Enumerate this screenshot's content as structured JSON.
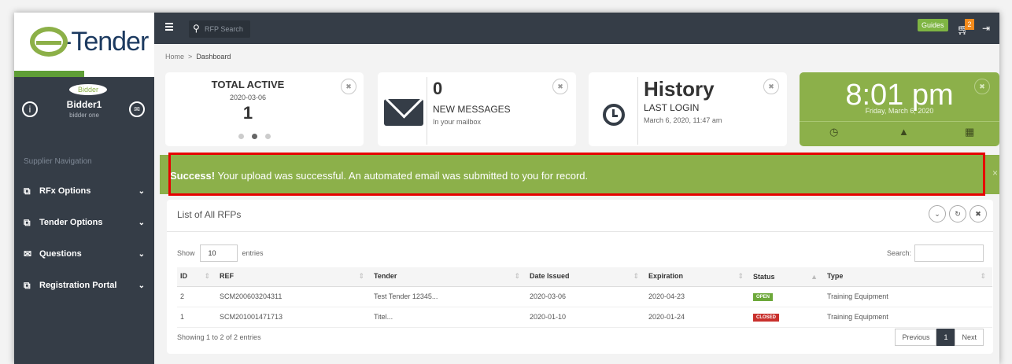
{
  "brand": {
    "logo_text": "-Tender"
  },
  "user": {
    "role": "Bidder",
    "name": "Bidder1",
    "sub": "bidder one"
  },
  "sidebar": {
    "heading": "Supplier Navigation",
    "items": [
      {
        "label": "RFx Options"
      },
      {
        "label": "Tender Options"
      },
      {
        "label": "Questions"
      },
      {
        "label": "Registration Portal"
      }
    ]
  },
  "topbar": {
    "search_placeholder": "RFP Search",
    "guides": "Guides",
    "cart_count": "2"
  },
  "breadcrumb": {
    "home": "Home",
    "sep": ">",
    "current": "Dashboard"
  },
  "cards": {
    "active": {
      "title": "TOTAL ACTIVE",
      "date": "2020-03-06",
      "count": "1"
    },
    "messages": {
      "count": "0",
      "title": "NEW MESSAGES",
      "sub": "In your mailbox"
    },
    "history": {
      "title": "History",
      "sub": "LAST LOGIN",
      "date": "March 6, 2020, 11:47 am"
    },
    "clock": {
      "time": "8:01 pm",
      "date": "Friday, March 6, 2020"
    }
  },
  "alert": {
    "strong": "Success!",
    "text": " Your upload was successful. An automated email was submitted to you for record."
  },
  "panel": {
    "title": "List of All RFPs",
    "show": "Show",
    "entries_value": "10",
    "entries": "entries",
    "search": "Search:",
    "columns": [
      "ID",
      "REF",
      "Tender",
      "Date Issued",
      "Expiration",
      "Status",
      "Type"
    ],
    "rows": [
      {
        "id": "2",
        "ref": "SCM200603204311",
        "tender": "Test Tender 12345...",
        "issued": "2020-03-06",
        "expiration": "2020-04-23",
        "status": "OPEN",
        "type": "Training Equipment"
      },
      {
        "id": "1",
        "ref": "SCM201001471713",
        "tender": "Titel...",
        "issued": "2020-01-10",
        "expiration": "2020-01-24",
        "status": "CLOSED",
        "type": "Training Equipment"
      }
    ],
    "info": "Showing 1 to 2 of 2 entries",
    "prev": "Previous",
    "page": "1",
    "next": "Next"
  },
  "colors": {
    "accent": "#8cb04a",
    "dark": "#353d47",
    "alert_border": "#e60000"
  }
}
